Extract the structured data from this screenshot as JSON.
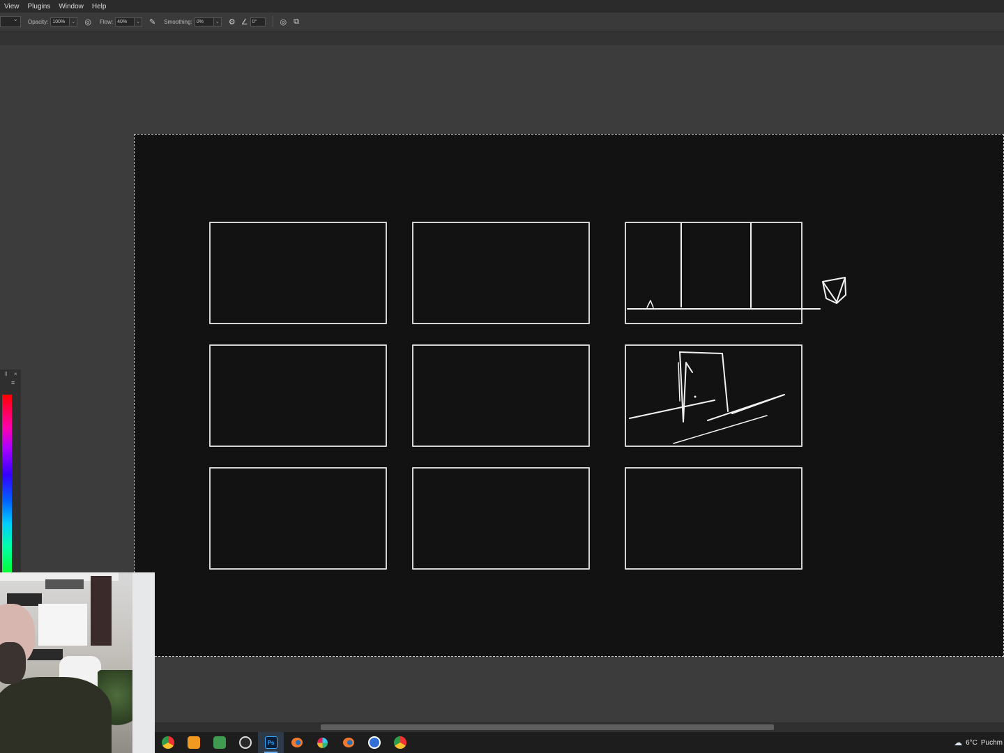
{
  "menu": [
    "View",
    "Plugins",
    "Window",
    "Help"
  ],
  "options": {
    "opacity_label": "Opacity:",
    "opacity_value": "100%",
    "flow_label": "Flow:",
    "flow_value": "40%",
    "smoothing_label": "Smoothing:",
    "smoothing_value": "0%",
    "angle_value": "0°",
    "icons": [
      "pressure-opacity-icon",
      "airbrush-icon",
      "settings-gear-icon",
      "angle-icon",
      "pressure-size-icon",
      "symmetry-icon"
    ]
  },
  "storyboard": {
    "rows": 3,
    "columns": 3,
    "panels": [
      {
        "id": "panel-1",
        "sketch": false
      },
      {
        "id": "panel-2",
        "sketch": false
      },
      {
        "id": "panel-3",
        "sketch": true
      },
      {
        "id": "panel-4",
        "sketch": false
      },
      {
        "id": "panel-5",
        "sketch": false
      },
      {
        "id": "panel-6",
        "sketch": true
      },
      {
        "id": "panel-7",
        "sketch": false
      },
      {
        "id": "panel-8",
        "sketch": false
      },
      {
        "id": "panel-9",
        "sketch": false
      }
    ]
  },
  "colors": {
    "canvas": "#121212",
    "workspace": "#3c3c3c",
    "panel_border": "#d4d4d4",
    "taskbar": "#1d1d1d"
  },
  "taskbar": {
    "apps": [
      "chrome-icon",
      "app-orange-icon",
      "app-green-icon",
      "obs-icon",
      "photoshop-icon",
      "blender-icon",
      "slack-icon",
      "blender-icon-2",
      "word-icon",
      "chrome-icon-2"
    ],
    "active_app": "Ps",
    "weather_temp": "6°C",
    "weather_location": "Puchm"
  }
}
